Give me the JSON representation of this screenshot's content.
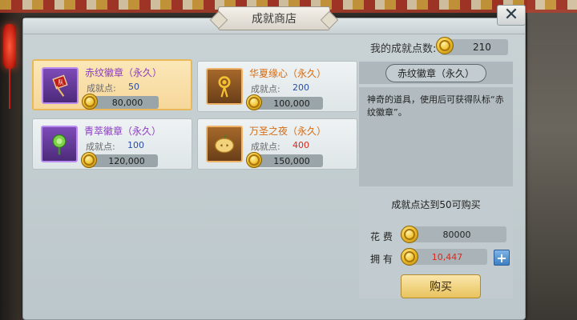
{
  "window": {
    "title": "成就商店",
    "close_label": "✕"
  },
  "points": {
    "label": "我的成就点数:",
    "value": "210"
  },
  "items": [
    {
      "name": "赤纹徽章（永久）",
      "points_label": "成就点:",
      "points": "50",
      "price": "80,000",
      "rarity": "purple",
      "icon": "flag-badge-icon",
      "selected": true
    },
    {
      "name": "华夏缘心（永久）",
      "points_label": "成就点:",
      "points": "200",
      "price": "100,000",
      "rarity": "orange",
      "icon": "chinese-knot-icon",
      "selected": false
    },
    {
      "name": "青萃徽章（永久）",
      "points_label": "成就点:",
      "points": "100",
      "price": "120,000",
      "rarity": "purple",
      "icon": "green-fan-icon",
      "selected": false
    },
    {
      "name": "万圣之夜（永久）",
      "points_label": "成就点:",
      "points": "400",
      "price": "150,000",
      "rarity": "orange",
      "icon": "pumpkin-icon",
      "selected": false,
      "points_insufficient": true
    }
  ],
  "detail": {
    "title": "赤纹徽章（永久）",
    "description": "神奇的道具，使用后可获得队标“赤纹徽章”。",
    "requirement": "成就点达到50可购买",
    "cost_label": "花   费",
    "cost_value": "80000",
    "own_label": "拥   有",
    "own_value": "10,447",
    "plus_label": "+",
    "buy_label": "购买"
  },
  "colors": {
    "purple_name": "#8a3ac2",
    "orange_name": "#d66a10",
    "points_blue": "#2a4da0",
    "points_red": "#d62a1e",
    "selected_bg": "#f6d79a"
  }
}
